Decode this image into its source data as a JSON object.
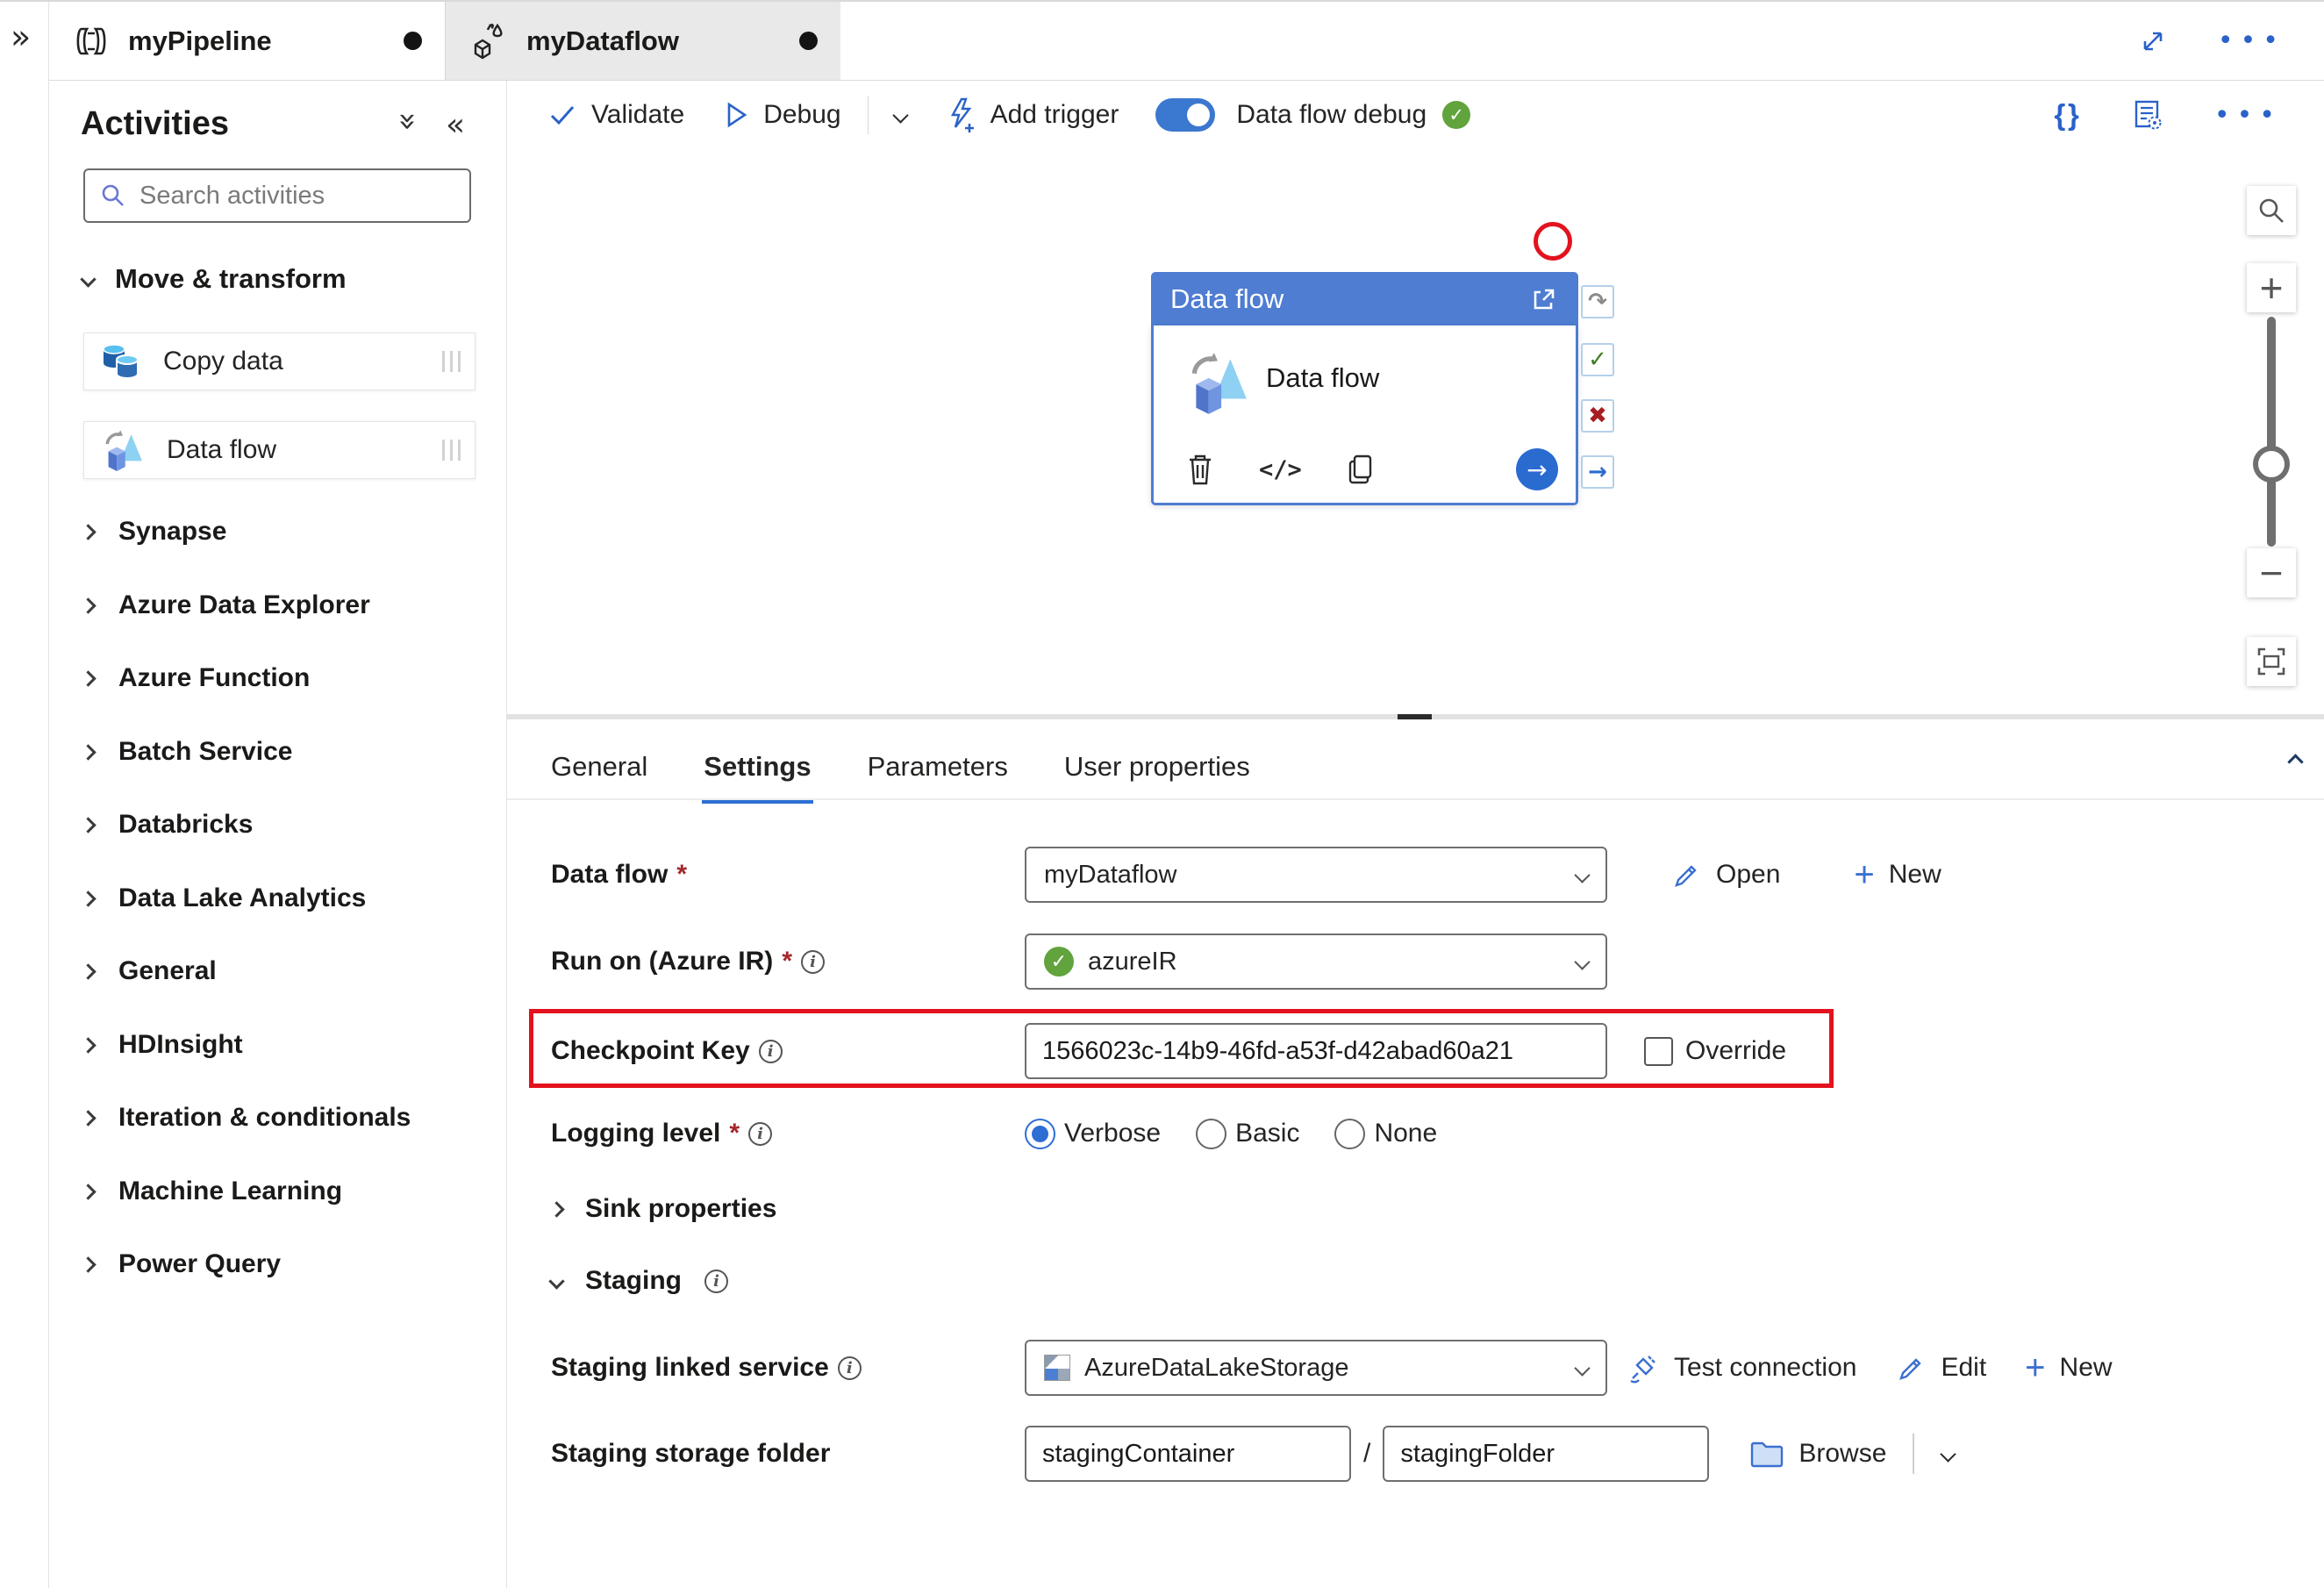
{
  "tabs": {
    "pipeline": {
      "label": "myPipeline"
    },
    "dataflow": {
      "label": "myDataflow"
    }
  },
  "toolbar": {
    "validate": "Validate",
    "debug": "Debug",
    "add_trigger": "Add trigger",
    "dataflow_debug": "Data flow debug"
  },
  "sidebar": {
    "title": "Activities",
    "search_placeholder": "Search activities",
    "section": "Move & transform",
    "items": [
      {
        "label": "Copy data"
      },
      {
        "label": "Data flow"
      }
    ],
    "categories": [
      "Synapse",
      "Azure Data Explorer",
      "Azure Function",
      "Batch Service",
      "Databricks",
      "Data Lake Analytics",
      "General",
      "HDInsight",
      "Iteration & conditionals",
      "Machine Learning",
      "Power Query"
    ]
  },
  "canvas": {
    "node": {
      "header": "Data flow",
      "label": "Data flow"
    },
    "state_icons": {
      "rerun": "↷",
      "succeed": "✓",
      "fail": "✖",
      "skip": "→",
      "go": "→",
      "check_badge": "✓"
    }
  },
  "panel": {
    "tabs": [
      "General",
      "Settings",
      "Parameters",
      "User properties"
    ],
    "active_tab": "Settings",
    "data_flow": {
      "label": "Data flow",
      "value": "myDataflow",
      "open": "Open",
      "new": "New"
    },
    "run_on": {
      "label": "Run on (Azure IR)",
      "value": "azureIR"
    },
    "checkpoint": {
      "label": "Checkpoint Key",
      "value": "1566023c-14b9-46fd-a53f-d42abad60a21",
      "override_label": "Override"
    },
    "logging": {
      "label": "Logging level",
      "options": [
        "Verbose",
        "Basic",
        "None"
      ],
      "selected": "Verbose"
    },
    "sink": {
      "label": "Sink properties"
    },
    "staging": {
      "label": "Staging"
    },
    "staging_linked_service": {
      "label": "Staging linked service",
      "value": "AzureDataLakeStorage",
      "test": "Test connection",
      "edit": "Edit",
      "new": "New"
    },
    "staging_storage_folder": {
      "label": "Staging storage folder",
      "container": "stagingContainer",
      "separator": "/",
      "folder": "stagingFolder",
      "browse": "Browse"
    }
  },
  "colors": {
    "accent": "#2d6ed3",
    "node_header": "#4e7dd2",
    "highlight_red": "#e3121e",
    "success_green": "#61a33c",
    "toggle_blue": "#3b78d0"
  }
}
